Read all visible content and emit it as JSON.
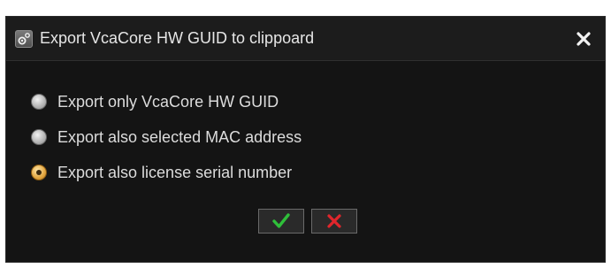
{
  "dialog": {
    "title": "Export VcaCore HW GUID to clippoard",
    "icon": "settings-icon",
    "close_icon": "close-icon"
  },
  "options": [
    {
      "label": "Export only VcaCore HW GUID",
      "selected": false
    },
    {
      "label": "Export also selected MAC address",
      "selected": false
    },
    {
      "label": "Export also license serial number",
      "selected": true
    }
  ],
  "buttons": {
    "ok_icon": "checkmark-icon",
    "cancel_icon": "x-icon"
  },
  "colors": {
    "background": "#141414",
    "text": "#dcdcdc",
    "ok_green": "#2fbf3a",
    "cancel_red": "#e0262c",
    "selected_radio": "#e3a640"
  }
}
